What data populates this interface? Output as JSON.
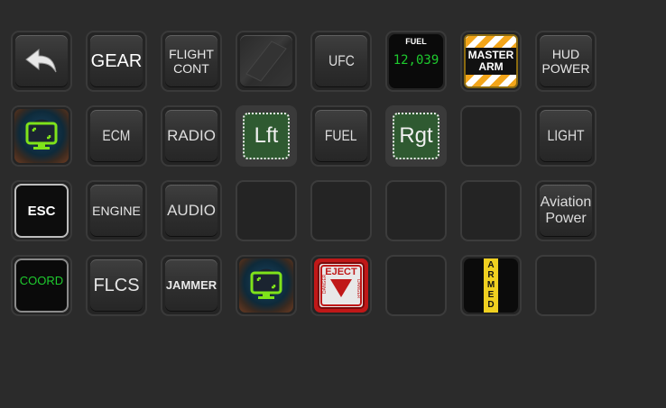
{
  "panel": {
    "row1": {
      "back": {
        "icon": "back-arrow-icon"
      },
      "gear": "GEAR",
      "flight_cont": "FLIGHT\nCONT",
      "blank_key": {
        "icon": "blank-glass-key"
      },
      "ufc": "UFC",
      "fuel": {
        "label": "FUEL",
        "value": "12,039"
      },
      "master_arm": "MASTER\nARM",
      "hud_power": "HUD\nPOWER"
    },
    "row2": {
      "screen": {
        "icon": "monitor-screen-icon"
      },
      "ecm": "ECM",
      "radio": "RADIO",
      "lft": "Lft",
      "fuel": "FUEL",
      "rgt": "Rgt",
      "light": "LIGHT"
    },
    "row3": {
      "esc": "ESC",
      "engine": "ENGINE",
      "audio": "AUDIO",
      "aviation_power": "Aviation\nPower"
    },
    "row4": {
      "coord": "COORD",
      "flcs": "FLCS",
      "jammer": "JAMMER",
      "screen": {
        "icon": "monitor-screen-icon"
      },
      "eject": {
        "title": "EJECT",
        "warning": "DANGER"
      },
      "armed": "ARMED"
    }
  },
  "colors": {
    "background": "#2b2b2b",
    "green_text": "#1ecb2e",
    "eject_red": "#c01818",
    "arm_orange": "#f2a51a",
    "armed_yellow": "#f0d020",
    "lft_green": "#2f5a31"
  }
}
